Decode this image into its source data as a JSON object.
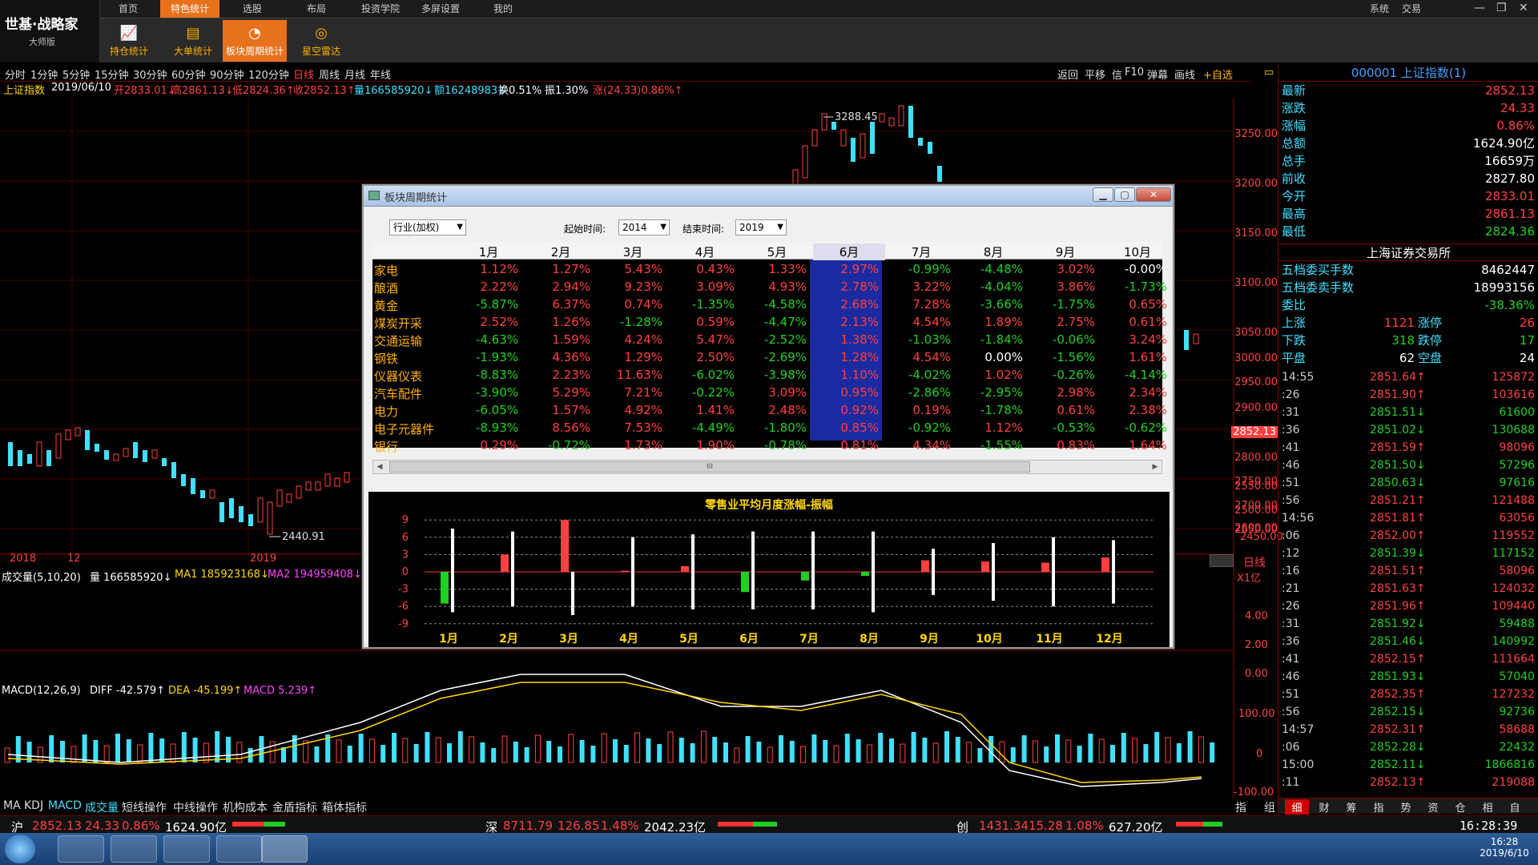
{
  "app": {
    "logo": "世基·战略家",
    "edition": "大师版"
  },
  "menu": [
    "首页",
    "特色统计",
    "选股",
    "布局",
    "投资学院",
    "多屏设置",
    "我的"
  ],
  "menu_active": "特色统计",
  "menu_right": [
    "系统",
    "交易"
  ],
  "subtools": [
    {
      "label": "持仓统计"
    },
    {
      "label": "大单统计"
    },
    {
      "label": "板块周期统计"
    },
    {
      "label": "星空雷达"
    }
  ],
  "periods": [
    "分时",
    "1分钟",
    "5分钟",
    "15分钟",
    "30分钟",
    "60分钟",
    "90分钟",
    "120分钟",
    "日线",
    "周线",
    "月线",
    "年线"
  ],
  "period_active": "日线",
  "toolbar_right": [
    "返回",
    "平移",
    "信",
    "F10",
    "弹幕",
    "画线",
    "+自选"
  ],
  "infoline": {
    "name": "上证指数",
    "date": "2019/06/10",
    "open": "开2833.01↓",
    "high": "高2861.13↓",
    "low": "低2824.36↑",
    "close": "收2852.13↑",
    "vol": "量166585920↓",
    "amt": "额16248983↓",
    "turn": "换0.51%",
    "amp": "振1.30%",
    "chg": "涨(24.33)0.86%↑"
  },
  "price_axis": [
    "3250.00",
    "3200.00",
    "3150.00",
    "3100.00",
    "3050.00",
    "3000.00",
    "2950.00",
    "2900.00",
    "2850.00",
    "2800.00",
    "2750.00",
    "2700.00",
    "2650.00",
    "2600.00",
    "2550.00",
    "2500.00",
    "2450.00"
  ],
  "price_label": "2852.13",
  "annot": {
    "high": "3288.45",
    "low": "2440.91"
  },
  "xlabels": {
    "y2018": "2018",
    "m12": "12",
    "y2019": "2019"
  },
  "daily_label": "日线",
  "vol_unit": "X1亿",
  "vol_axis": [
    "4.00",
    "2.00",
    "0.00"
  ],
  "vol_line": {
    "title": "成交量(5,10,20)",
    "vol": "量 166585920↓",
    "ma1": "MA1 185923168↓",
    "ma2": "MA2 194959408↓"
  },
  "macd_line": {
    "title": "MACD(12,26,9)",
    "diff": "DIFF -42.579↑",
    "dea": "DEA -45.199↑",
    "macd": "MACD 5.239↑"
  },
  "macd_axis": [
    "100.00",
    "0",
    "-100.00"
  ],
  "indicators": [
    "MA",
    "KDJ",
    "MACD",
    "成交量",
    "短线操作",
    "中线操作",
    "机构成本",
    "金盾指标",
    "箱体指标"
  ],
  "right": {
    "title": "000001 上证指数(1)",
    "rows": [
      [
        "最新",
        "2852.13",
        "red"
      ],
      [
        "涨跌",
        "24.33",
        "red"
      ],
      [
        "涨幅",
        "0.86%",
        "red"
      ],
      [
        "总额",
        "1624.90亿",
        "wht"
      ],
      [
        "总手",
        "16659万",
        "wht"
      ],
      [
        "前收",
        "2827.80",
        "wht"
      ],
      [
        "今开",
        "2833.01",
        "red"
      ],
      [
        "最高",
        "2861.13",
        "red"
      ],
      [
        "最低",
        "2824.36",
        "grn"
      ]
    ],
    "exchange": "上海证券交易所",
    "rows2": [
      [
        "五档委买手数",
        "8462447",
        "wht"
      ],
      [
        "五档委卖手数",
        "18993156",
        "wht"
      ],
      [
        "委比",
        "-38.36%",
        "grn"
      ]
    ],
    "updown": [
      [
        "上涨",
        "1121",
        "涨停",
        "26"
      ],
      [
        "下跌",
        "318",
        "跌停",
        "17"
      ],
      [
        "平盘",
        "62",
        "空盘",
        "24"
      ]
    ],
    "ticks": [
      [
        "14:55",
        "2851.64↑",
        "125872"
      ],
      [
        ":26",
        "2851.90↑",
        "103616"
      ],
      [
        ":31",
        "2851.51↓",
        "61600"
      ],
      [
        ":36",
        "2851.02↓",
        "130688"
      ],
      [
        ":41",
        "2851.59↑",
        "98096"
      ],
      [
        ":46",
        "2851.50↓",
        "57296"
      ],
      [
        ":51",
        "2850.63↓",
        "97616"
      ],
      [
        ":56",
        "2851.21↑",
        "121488"
      ],
      [
        "14:56",
        "2851.81↑",
        "63056"
      ],
      [
        ":06",
        "2852.00↑",
        "119552"
      ],
      [
        ":12",
        "2851.39↓",
        "117152"
      ],
      [
        ":16",
        "2851.51↑",
        "58096"
      ],
      [
        ":21",
        "2851.63↑",
        "124032"
      ],
      [
        ":26",
        "2851.96↑",
        "109440"
      ],
      [
        ":31",
        "2851.92↓",
        "59488"
      ],
      [
        ":36",
        "2851.46↓",
        "140992"
      ],
      [
        ":41",
        "2852.15↑",
        "111664"
      ],
      [
        ":46",
        "2851.93↓",
        "57040"
      ],
      [
        ":51",
        "2852.35↑",
        "127232"
      ],
      [
        ":56",
        "2852.15↓",
        "92736"
      ],
      [
        "14:57",
        "2852.31↑",
        "58688"
      ],
      [
        ":06",
        "2852.28↓",
        "22432"
      ],
      [
        "15:00",
        "2852.11↓",
        "1866816"
      ],
      [
        ":11",
        "2852.13↑",
        "219088"
      ]
    ],
    "tabs": [
      "细",
      "财",
      "筹",
      "指",
      "势",
      "资",
      "仓",
      "相",
      "自"
    ],
    "left_tabs": [
      "指",
      "组"
    ]
  },
  "dialog": {
    "title": "板块周期统计",
    "category": "行业(加权)",
    "start_label": "起始时间:",
    "start": "2014",
    "end_label": "结束时间:",
    "end": "2019",
    "months": [
      "1月",
      "2月",
      "3月",
      "4月",
      "5月",
      "6月",
      "7月",
      "8月",
      "9月",
      "10月"
    ],
    "active_month": "6月",
    "rows": [
      {
        "name": "家电",
        "v": [
          "1.12%",
          "1.27%",
          "5.43%",
          "0.43%",
          "1.33%",
          "2.97%",
          "-0.99%",
          "-4.48%",
          "3.02%",
          "-0.00%"
        ]
      },
      {
        "name": "酿酒",
        "v": [
          "2.22%",
          "2.94%",
          "9.23%",
          "3.09%",
          "4.93%",
          "2.78%",
          "3.22%",
          "-4.04%",
          "3.86%",
          "-1.73%"
        ]
      },
      {
        "name": "黄金",
        "v": [
          "-5.87%",
          "6.37%",
          "0.74%",
          "-1.35%",
          "-4.58%",
          "2.68%",
          "7.28%",
          "-3.66%",
          "-1.75%",
          "0.65%"
        ]
      },
      {
        "name": "煤炭开采",
        "v": [
          "2.52%",
          "1.26%",
          "-1.28%",
          "0.59%",
          "-4.47%",
          "2.13%",
          "4.54%",
          "1.89%",
          "2.75%",
          "0.61%"
        ]
      },
      {
        "name": "交通运输",
        "v": [
          "-4.63%",
          "1.59%",
          "4.24%",
          "5.47%",
          "-2.52%",
          "1.38%",
          "-1.03%",
          "-1.84%",
          "-0.06%",
          "3.24%"
        ]
      },
      {
        "name": "钢铁",
        "v": [
          "-1.93%",
          "4.36%",
          "1.29%",
          "2.50%",
          "-2.69%",
          "1.28%",
          "4.54%",
          "0.00%",
          "-1.56%",
          "1.61%"
        ]
      },
      {
        "name": "仪器仪表",
        "v": [
          "-8.83%",
          "2.23%",
          "11.63%",
          "-6.02%",
          "-3.98%",
          "1.10%",
          "-4.02%",
          "1.02%",
          "-0.26%",
          "-4.14%"
        ]
      },
      {
        "name": "汽车配件",
        "v": [
          "-3.90%",
          "5.29%",
          "7.21%",
          "-0.22%",
          "3.09%",
          "0.95%",
          "-2.86%",
          "-2.95%",
          "2.98%",
          "2.34%"
        ]
      },
      {
        "name": "电力",
        "v": [
          "-6.05%",
          "1.57%",
          "4.92%",
          "1.41%",
          "2.48%",
          "0.92%",
          "0.19%",
          "-1.78%",
          "0.61%",
          "2.38%"
        ]
      },
      {
        "name": "电子元器件",
        "v": [
          "-8.93%",
          "8.56%",
          "7.53%",
          "-4.49%",
          "-1.80%",
          "0.85%",
          "-0.92%",
          "1.12%",
          "-0.53%",
          "-0.62%"
        ]
      },
      {
        "name": "银行",
        "v": [
          "0.29%",
          "-0.72%",
          "1.73%",
          "1.90%",
          "-0.78%",
          "0.81%",
          "4.34%",
          "-1.55%",
          "0.83%",
          "1.64%"
        ]
      }
    ],
    "scroll_mark": "III",
    "chart_title": "零售业平均月度涨幅-振幅"
  },
  "chart_data": {
    "type": "bar",
    "title": "零售业平均月度涨幅-振幅",
    "categories": [
      "1月",
      "2月",
      "3月",
      "4月",
      "5月",
      "6月",
      "7月",
      "8月",
      "9月",
      "10月",
      "11月",
      "12月"
    ],
    "ylim": [
      -9,
      9
    ],
    "yticks": [
      "9",
      "6",
      "3",
      "0",
      "-3",
      "-6",
      "-9"
    ],
    "series": [
      {
        "name": "涨幅",
        "values": [
          -5.5,
          3,
          9,
          0.2,
          1,
          -3.5,
          -1.5,
          -0.7,
          2,
          1.8,
          1.6,
          2.5
        ]
      },
      {
        "name": "振幅上",
        "values": [
          7.5,
          7,
          0,
          6,
          6.5,
          7,
          7,
          7,
          4,
          5,
          6,
          5.5
        ]
      },
      {
        "name": "振幅下",
        "values": [
          -7,
          -6,
          -7.5,
          -6,
          -6.5,
          -6.5,
          -6.5,
          -7,
          -4,
          -5,
          -6,
          -5.5
        ]
      }
    ]
  },
  "status": {
    "sh": "沪",
    "sh_px": "2852.13",
    "sh_chg": "24.33",
    "sh_pct": "0.86%",
    "sh_amt": "1624.90亿",
    "sz": "深",
    "sz_px": "8711.79",
    "sz_chg": "126.85",
    "sz_pct": "1.48%",
    "sz_amt": "2042.23亿",
    "cy": "创",
    "cy_px": "1431.34",
    "cy_chg": "15.28",
    "cy_pct": "1.08%",
    "cy_amt": "627.20亿",
    "time": "16:28:39"
  },
  "taskbar": {
    "time": "16:28",
    "date": "2019/6/10"
  },
  "colors": {
    "up": "#ff4040",
    "down": "#20d020",
    "accent": "#e8721c"
  }
}
